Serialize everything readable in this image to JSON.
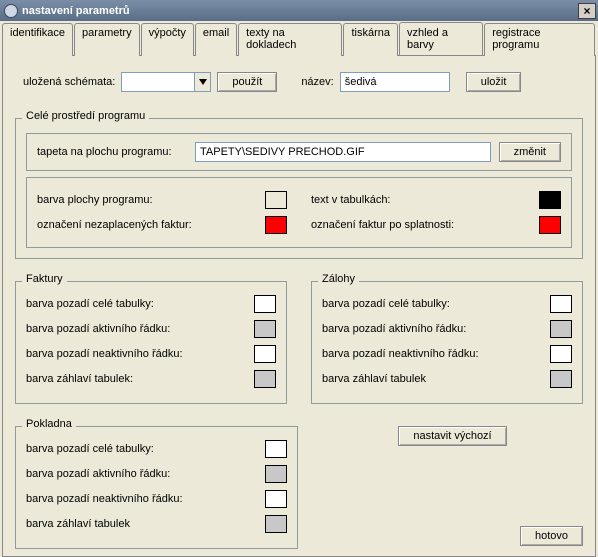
{
  "window": {
    "title": "nastavení parametrů"
  },
  "tabs": {
    "t0": "identifikace",
    "t1": "parametry",
    "t2": "výpočty",
    "t3": "email",
    "t4": "texty na dokladech",
    "t5": "tiskárna",
    "t6": "vzhled a barvy",
    "t7": "registrace programu"
  },
  "schema": {
    "saved_label": "uložená schémata:",
    "use_btn": "použít",
    "name_label": "název:",
    "name_value": "šedivá",
    "save_btn": "uložit"
  },
  "env": {
    "title": "Celé prostředí programu",
    "wallpaper_label": "tapeta na plochu programu:",
    "wallpaper_value": "TAPETY\\SEDIVY PRECHOD.GIF",
    "change_btn": "změnit",
    "bg_label": "barva plochy programu:",
    "text_label": "text v tabulkách:",
    "unpaid_label": "označení nezaplacených faktur:",
    "overdue_label": "označení faktur po splatnosti:"
  },
  "colors": {
    "bg": "#ece9d8",
    "text": "#000000",
    "unpaid": "#ff0000",
    "overdue": "#ff0000",
    "white": "#ffffff",
    "gray": "#c8c8c8"
  },
  "sections": {
    "faktury": "Faktury",
    "zalohy": "Zálohy",
    "pokladna": "Pokladna"
  },
  "labels": {
    "row_bg": "barva pozadí celé tabulky:",
    "row_active": "barva pozadí aktivního řádku:",
    "row_inactive": "barva pozadí neaktivního řádku:",
    "header": "barva záhlaví tabulek:",
    "header2": "barva záhlaví tabulek"
  },
  "defaults_btn": "nastavit výchozí",
  "done_btn": "hotovo"
}
